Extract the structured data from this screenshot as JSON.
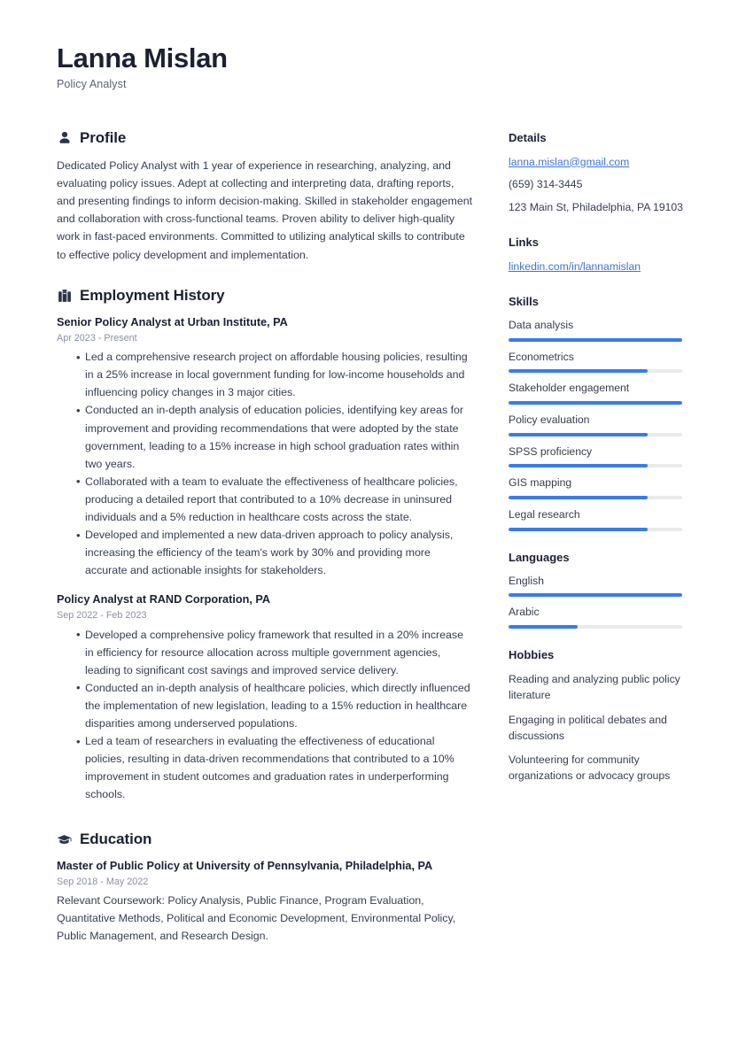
{
  "theme": {
    "accent": "#3b7af0",
    "link": "#3f72d8",
    "heading": "#1b2033",
    "text": "#353d4f",
    "muted": "#8a909f",
    "track": "#e9eaec"
  },
  "header": {
    "full_name": "Lanna Mislan",
    "job_title": "Policy Analyst"
  },
  "profile": {
    "section_title": "Profile",
    "icon": "user-icon",
    "text": "Dedicated Policy Analyst with 1 year of experience in researching, analyzing, and evaluating policy issues. Adept at collecting and interpreting data, drafting reports, and presenting findings to inform decision-making. Skilled in stakeholder engagement and collaboration with cross-functional teams. Proven ability to deliver high-quality work in fast-paced environments. Committed to utilizing analytical skills to contribute to effective policy development and implementation."
  },
  "employment": {
    "section_title": "Employment History",
    "icon": "briefcase-icon",
    "entries": [
      {
        "title": "Senior Policy Analyst at Urban Institute, PA",
        "date": "Apr 2023 - Present",
        "bullets": [
          "Led a comprehensive research project on affordable housing policies, resulting in a 25% increase in local government funding for low-income households and influencing policy changes in 3 major cities.",
          "Conducted an in-depth analysis of education policies, identifying key areas for improvement and providing recommendations that were adopted by the state government, leading to a 15% increase in high school graduation rates within two years.",
          "Collaborated with a team to evaluate the effectiveness of healthcare policies, producing a detailed report that contributed to a 10% decrease in uninsured individuals and a 5% reduction in healthcare costs across the state.",
          "Developed and implemented a new data-driven approach to policy analysis, increasing the efficiency of the team's work by 30% and providing more accurate and actionable insights for stakeholders."
        ]
      },
      {
        "title": "Policy Analyst at RAND Corporation, PA",
        "date": "Sep 2022 - Feb 2023",
        "bullets": [
          "Developed a comprehensive policy framework that resulted in a 20% increase in efficiency for resource allocation across multiple government agencies, leading to significant cost savings and improved service delivery.",
          "Conducted an in-depth analysis of healthcare policies, which directly influenced the implementation of new legislation, leading to a 15% reduction in healthcare disparities among underserved populations.",
          "Led a team of researchers in evaluating the effectiveness of educational policies, resulting in data-driven recommendations that contributed to a 10% improvement in student outcomes and graduation rates in underperforming schools."
        ]
      }
    ]
  },
  "education": {
    "section_title": "Education",
    "icon": "graduation-cap-icon",
    "entries": [
      {
        "title": "Master of Public Policy at University of Pennsylvania, Philadelphia, PA",
        "date": "Sep 2018 - May 2022",
        "description": "Relevant Coursework: Policy Analysis, Public Finance, Program Evaluation, Quantitative Methods, Political and Economic Development, Environmental Policy, Public Management, and Research Design."
      }
    ]
  },
  "sidebar": {
    "details": {
      "title": "Details",
      "email": "lanna.mislan@gmail.com",
      "phone": "(659) 314-3445",
      "address": "123 Main St, Philadelphia, PA 19103"
    },
    "links": {
      "title": "Links",
      "items": [
        {
          "label": "linkedin.com/in/lannamislan"
        }
      ]
    },
    "skills": {
      "title": "Skills",
      "items": [
        {
          "label": "Data analysis",
          "level": 100
        },
        {
          "label": "Econometrics",
          "level": 80
        },
        {
          "label": "Stakeholder engagement",
          "level": 100
        },
        {
          "label": "Policy evaluation",
          "level": 80
        },
        {
          "label": "SPSS proficiency",
          "level": 80
        },
        {
          "label": "GIS mapping",
          "level": 80
        },
        {
          "label": "Legal research",
          "level": 80
        }
      ]
    },
    "languages": {
      "title": "Languages",
      "items": [
        {
          "label": "English",
          "level": 100
        },
        {
          "label": "Arabic",
          "level": 40
        }
      ]
    },
    "hobbies": {
      "title": "Hobbies",
      "items": [
        "Reading and analyzing public policy literature",
        "Engaging in political debates and discussions",
        "Volunteering for community organizations or advocacy groups"
      ]
    }
  }
}
